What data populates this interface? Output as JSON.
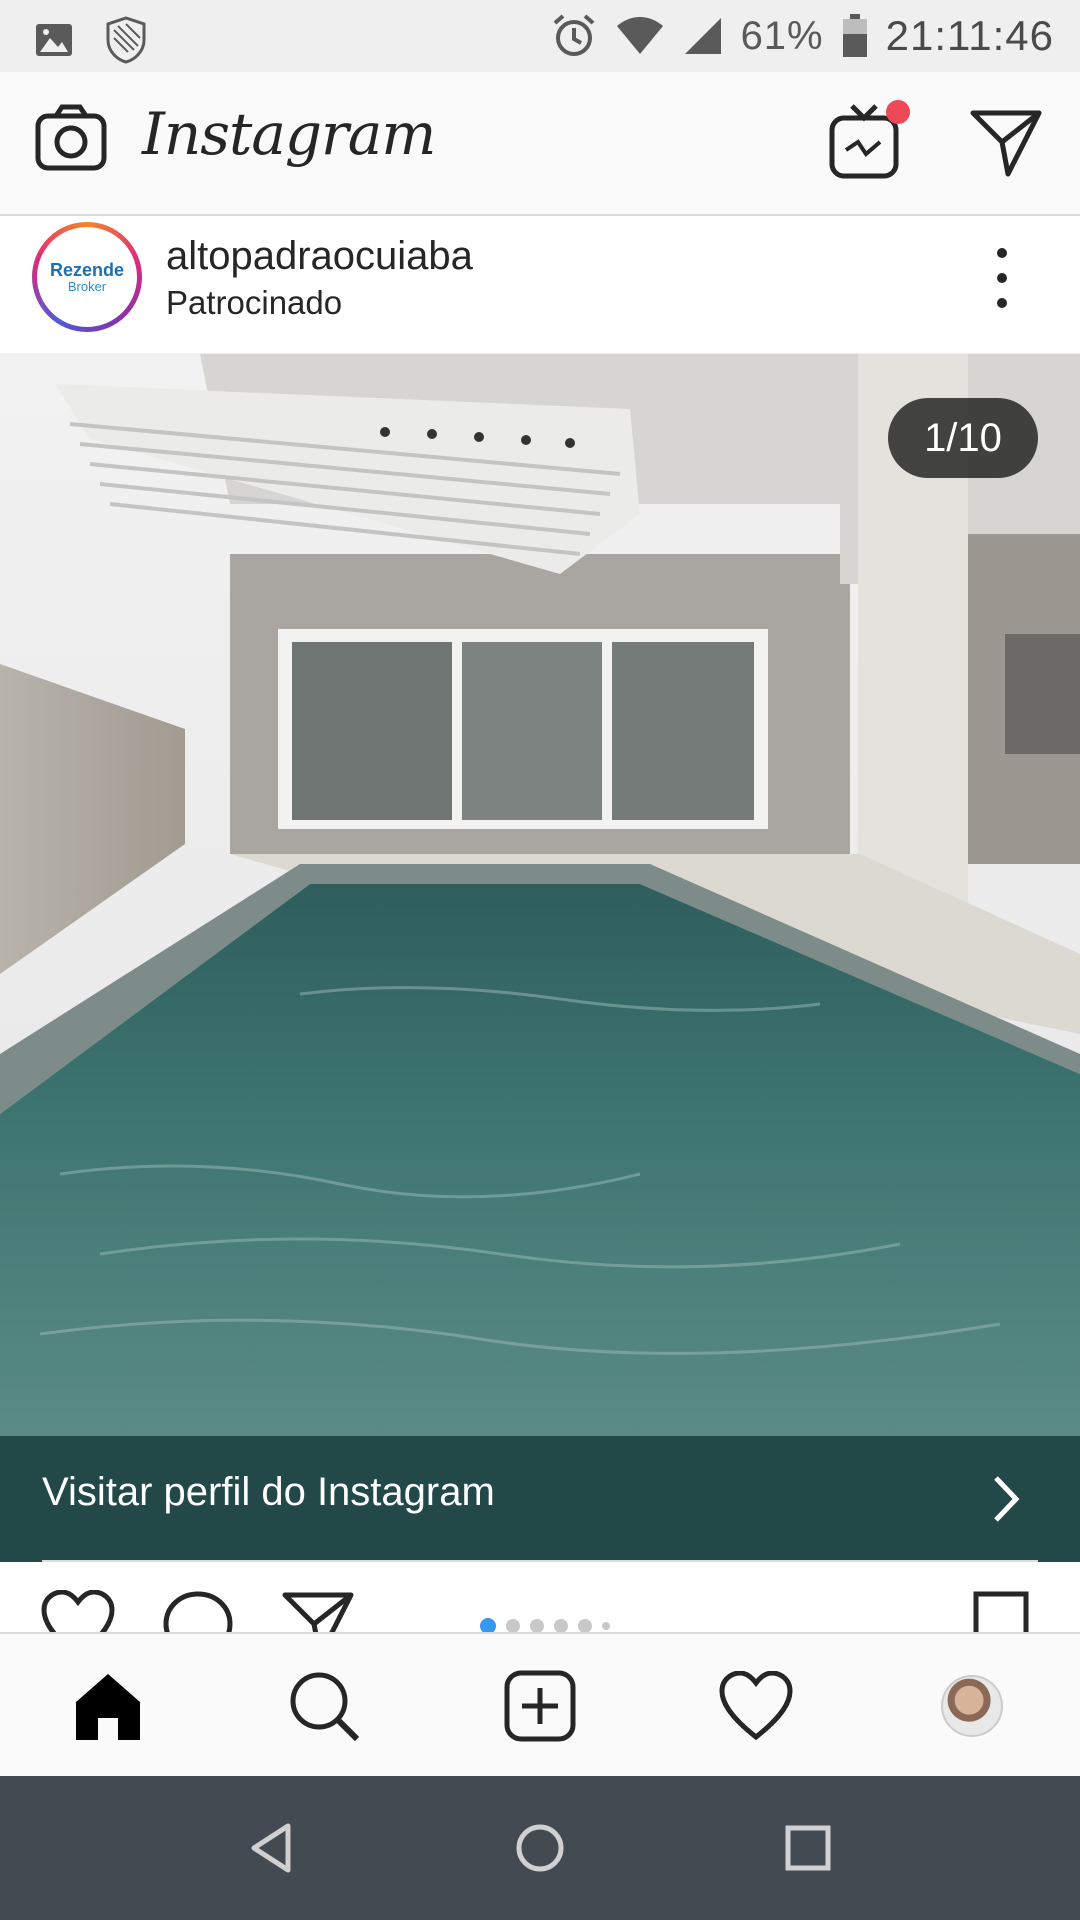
{
  "status_bar": {
    "battery_text": "61%",
    "time": "21:11:46",
    "icons": [
      "gallery-icon",
      "shield-icon",
      "alarm-icon",
      "wifi-icon",
      "signal-icon",
      "battery-icon"
    ]
  },
  "header": {
    "logo_text": "Instagram",
    "icons": [
      "camera-icon",
      "igtv-icon",
      "direct-message-icon"
    ],
    "igtv_badge_color": "#ed4956"
  },
  "post": {
    "username": "altopadraocuiaba",
    "sponsored_label": "Patrocinado",
    "avatar_text": "Rezende",
    "avatar_subtext": "Broker",
    "carousel_counter": "1/10",
    "current_slide": 1,
    "total_slides": 10,
    "cta_label": "Visitar perfil do Instagram",
    "cta_color": "#224848",
    "action_icons": [
      "heart-icon",
      "comment-icon",
      "share-icon",
      "bookmark-icon"
    ],
    "dot_active_color": "#3897f0"
  },
  "bottom_nav": {
    "items": [
      "home-icon",
      "search-icon",
      "add-post-icon",
      "activity-icon",
      "profile-avatar"
    ]
  },
  "system_nav": {
    "items": [
      "back-icon",
      "home-circle-icon",
      "recents-icon"
    ]
  }
}
